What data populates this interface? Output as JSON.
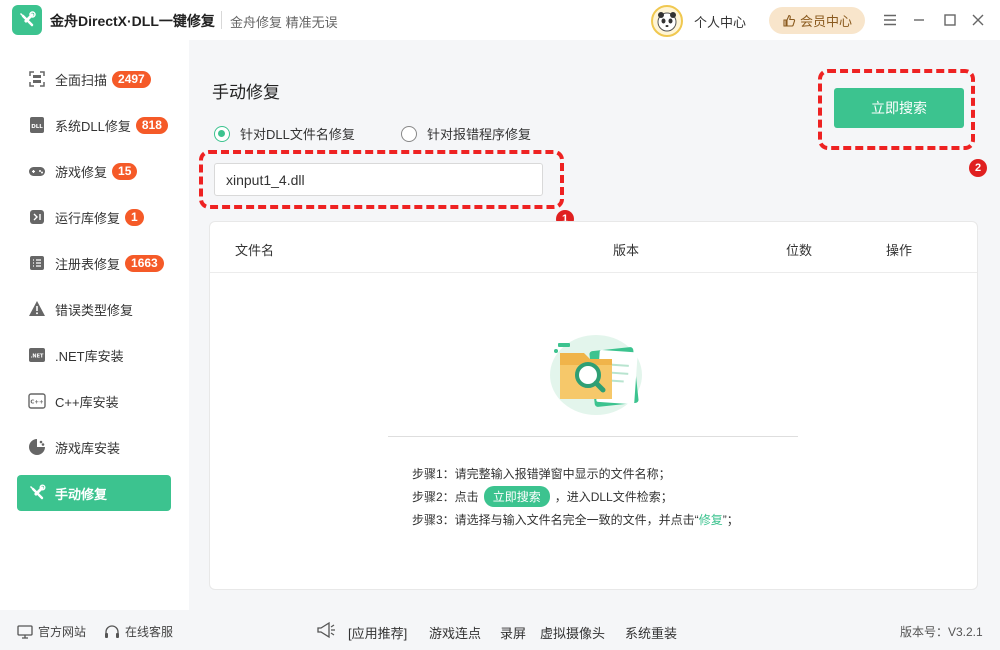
{
  "app": {
    "title": "金舟DirectX·DLL一键修复",
    "slogan": "金舟修复 精准无误",
    "personal_center": "个人中心",
    "vip_center": "会员中心"
  },
  "sidebar": {
    "items": [
      {
        "label": "全面扫描",
        "badge": "2497",
        "icon": "scan-icon"
      },
      {
        "label": "系统DLL修复",
        "badge": "818",
        "icon": "dll-icon"
      },
      {
        "label": "游戏修复",
        "badge": "15",
        "icon": "gamepad-icon"
      },
      {
        "label": "运行库修复",
        "badge": "1",
        "icon": "runtime-icon"
      },
      {
        "label": "注册表修复",
        "badge": "1663",
        "icon": "registry-icon"
      },
      {
        "label": "错误类型修复",
        "badge": "",
        "icon": "warning-icon"
      },
      {
        "label": ".NET库安装",
        "badge": "",
        "icon": "dotnet-icon"
      },
      {
        "label": "C++库安装",
        "badge": "",
        "icon": "cpp-icon"
      },
      {
        "label": "游戏库安装",
        "badge": "",
        "icon": "game-lib-icon"
      },
      {
        "label": "手动修复",
        "badge": "",
        "icon": "tools-icon",
        "active": true
      }
    ]
  },
  "main": {
    "title": "手动修复",
    "radio_dll": "针对DLL文件名修复",
    "radio_program": "针对报错程序修复",
    "file_input_value": "xinput1_4.dll",
    "search_button": "立即搜索",
    "marker1": "1",
    "marker2": "2",
    "table": {
      "col_name": "文件名",
      "col_version": "版本",
      "col_bits": "位数",
      "col_action": "操作"
    },
    "steps": {
      "step1": "步骤1：请完整输入报错弹窗中显示的文件名称；",
      "step2_prefix": "步骤2：点击",
      "step2_button": "立即搜索",
      "step2_suffix": "，进入DLL文件检索；",
      "step3_prefix": "步骤3：请选择与输入文件名完全一致的文件，并点击“",
      "step3_highlight": "修复",
      "step3_suffix": "”；"
    }
  },
  "footer": {
    "official_site": "官方网站",
    "online_service": "在线客服",
    "recommend_label": "[应用推荐]",
    "links": [
      "游戏连点",
      "录屏",
      "虚拟摄像头",
      "系统重装"
    ],
    "version": "版本号：V3.2.1"
  },
  "colors": {
    "accent": "#3cc38f",
    "badge": "#f55a28",
    "annotation": "#ee2222"
  }
}
